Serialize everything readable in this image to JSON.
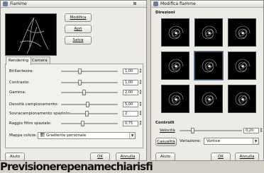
{
  "left_dialog": {
    "title": "Fiamme",
    "buttons": {
      "modifica": "Modifica",
      "apri": "Apri",
      "salva": "Salva"
    },
    "tabs": [
      "Rendering",
      "Camera"
    ],
    "rows": [
      {
        "label": "Brillantezza:",
        "value": "1,00",
        "level": 0.33
      },
      {
        "label": "Contrasto:",
        "value": "1,00",
        "level": 0.33
      },
      {
        "label": "Gamma:",
        "value": "2,00",
        "level": 0.4
      },
      {
        "label": "Densità campionamento:",
        "value": "5,00",
        "level": 0.46
      },
      {
        "label": "Sovracampionamento spaziale:",
        "value": "2",
        "level": 0.45
      },
      {
        "label": "Raggio filtro spaziale:",
        "value": "0,75",
        "level": 0.37
      }
    ],
    "colormap": {
      "label": "Mappa colore:",
      "value": "Gradiente personale"
    },
    "footer": {
      "help": "Aiuto",
      "ok": "OK",
      "cancel": "Annulla"
    }
  },
  "right_dialog": {
    "title": "Modifica fiamme",
    "directions_title": "Direzioni",
    "controls_title": "Controlli",
    "speed": {
      "label": "Velocità",
      "value": "0,20",
      "level": 0.2
    },
    "random_button": "Casualità",
    "variation": {
      "label": "Variazione:",
      "value": "Vortice"
    },
    "footer": {
      "help": "Aiuto",
      "ok": "OK",
      "cancel": "Annulla"
    }
  },
  "bottom_strip": {
    "text": "Previsionerepenamechiarisfi"
  }
}
